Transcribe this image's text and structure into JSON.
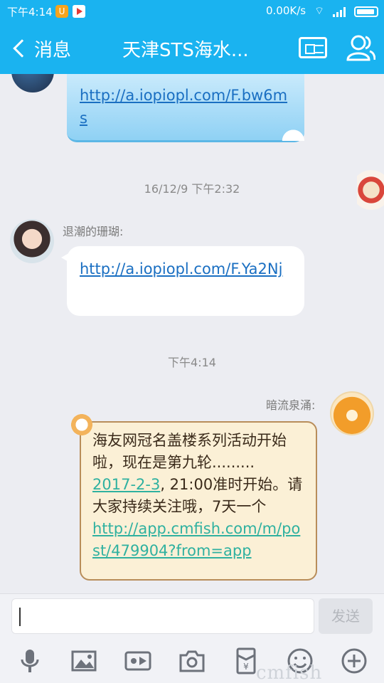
{
  "status_bar": {
    "time": "下午4:14",
    "net_speed": "0.00K/s"
  },
  "header": {
    "back_label": "消息",
    "title": "天津STS海水..."
  },
  "messages": [
    {
      "type": "link_bubble",
      "link": "http://a.iopiopl.com/F.bw6ms"
    },
    {
      "type": "timestamp",
      "text": "16/12/9 下午2:32"
    },
    {
      "type": "text",
      "sender": "退潮的珊瑚:",
      "link": "http://a.iopiopl.com/F.Ya2Nj"
    },
    {
      "type": "timestamp",
      "text": "下午4:14"
    },
    {
      "type": "card",
      "sender": "暗流泉涌:",
      "line1": "海友网冠名盖楼系列活动开始啦，现在是第九轮.........",
      "date_link": "2017-2-3",
      "line2": ", 21:00准时开始。请大家持续关注哦，7天一个",
      "post_link": "http://app.cmfish.com/m/post/479904?from=app"
    }
  ],
  "input": {
    "placeholder": "",
    "send_label": "发送"
  },
  "toolbar": {
    "icons": [
      "mic-icon",
      "image-icon",
      "video-call-icon",
      "camera-icon",
      "red-packet-icon",
      "emoji-icon",
      "plus-icon"
    ]
  },
  "watermark": "cmfish"
}
